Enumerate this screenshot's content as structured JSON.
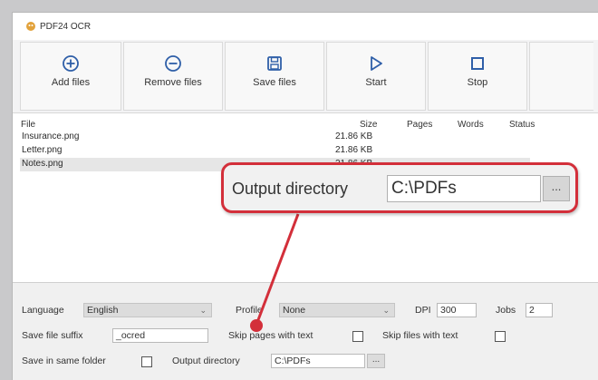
{
  "window": {
    "title": "PDF24 OCR"
  },
  "toolbar": {
    "add_files": "Add files",
    "remove_files": "Remove files",
    "save_files": "Save files",
    "start": "Start",
    "stop": "Stop"
  },
  "file_list": {
    "columns": {
      "file": "File",
      "size": "Size",
      "pages": "Pages",
      "words": "Words",
      "status": "Status"
    },
    "rows": [
      {
        "name": "Insurance.png",
        "size": "21.86 KB"
      },
      {
        "name": "Letter.png",
        "size": "21.86 KB"
      },
      {
        "name": "Notes.png",
        "size": "21.86 KB"
      }
    ]
  },
  "settings": {
    "language_label": "Language",
    "language_value": "English",
    "profile_label": "Profile",
    "profile_value": "None",
    "dpi_label": "DPI",
    "dpi_value": "300",
    "jobs_label": "Jobs",
    "jobs_value": "2",
    "suffix_label": "Save file suffix",
    "suffix_value": "_ocred",
    "skip_pages_label": "Skip pages with text",
    "skip_files_label": "Skip files with text",
    "same_folder_label": "Save in same folder",
    "output_dir_label": "Output directory",
    "output_dir_value": "C:\\PDFs",
    "browse_label": "..."
  },
  "callout": {
    "label": "Output directory",
    "value": "C:\\PDFs",
    "browse_label": "...",
    "border_color": "#d32f3a"
  },
  "icons": {
    "add": "plus-circle-icon",
    "remove": "minus-circle-icon",
    "save": "floppy-disk-icon",
    "start": "play-triangle-icon",
    "stop": "stop-square-icon"
  }
}
